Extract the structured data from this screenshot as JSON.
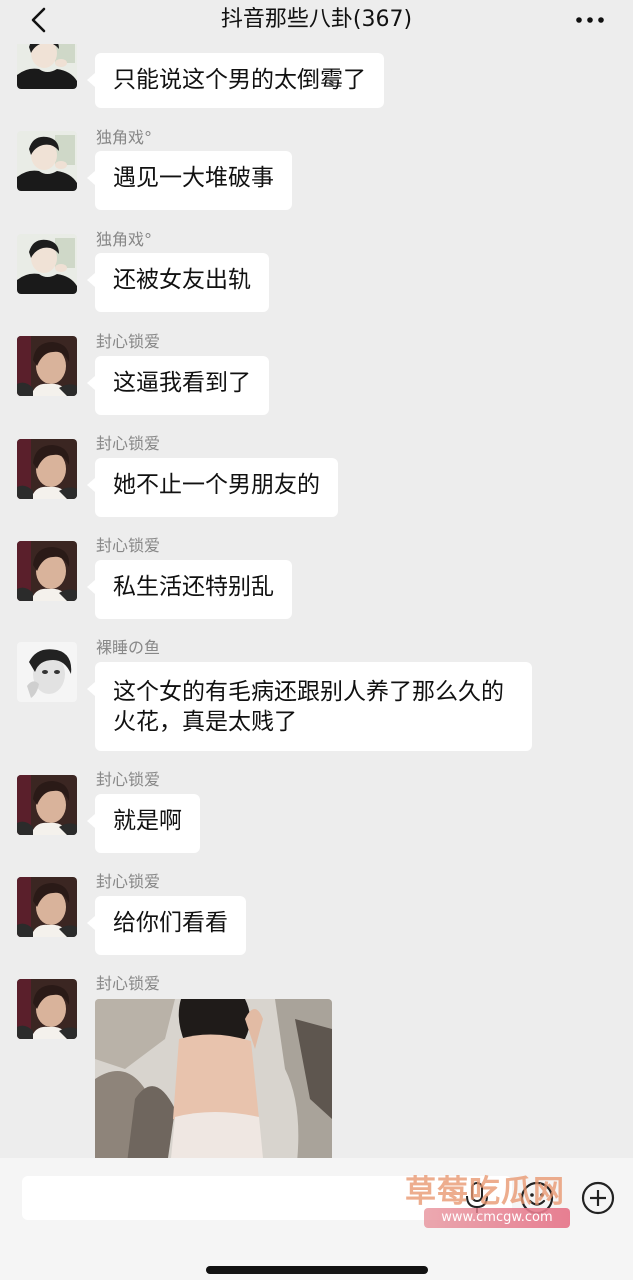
{
  "header": {
    "title": "抖音那些八卦(367)"
  },
  "messages": [
    {
      "sender": "",
      "text": "只能说这个男的太倒霉了"
    },
    {
      "sender": "独角戏°",
      "text": "遇见一大堆破事"
    },
    {
      "sender": "独角戏°",
      "text": "还被女友出轨"
    },
    {
      "sender": "封心锁爱",
      "text": "这逼我看到了"
    },
    {
      "sender": "封心锁爱",
      "text": "她不止一个男朋友的"
    },
    {
      "sender": "封心锁爱",
      "text": "私生活还特别乱"
    },
    {
      "sender": "裸睡の鱼",
      "text": "这个女的有毛病还跟别人养了那么久的火花，真是太贱了"
    },
    {
      "sender": "封心锁爱",
      "text": "就是啊"
    },
    {
      "sender": "封心锁爱",
      "text": "给你们看看"
    },
    {
      "sender": "封心锁爱",
      "text": ""
    }
  ],
  "watermark": {
    "name": "草莓吃瓜网",
    "url": "www.cmcgw.com"
  },
  "colors": {
    "chat_background": "#ededed",
    "bubble": "#ffffff",
    "sender_name": "#888888"
  },
  "icons": {
    "back": "chevron-left-icon",
    "more": "more-dots-icon",
    "voice": "microphone-icon",
    "emoji": "emoji-icon",
    "plus": "plus-circle-icon"
  }
}
